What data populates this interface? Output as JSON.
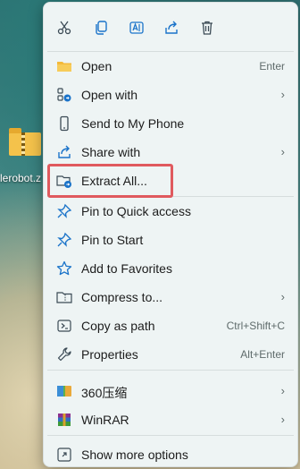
{
  "desktop": {
    "zip_file_label": "lerobot.z"
  },
  "toolbar": {
    "buttons": [
      "cut",
      "copy",
      "rename",
      "share",
      "delete"
    ]
  },
  "menu": {
    "items": [
      {
        "label": "Open",
        "shortcut": "Enter",
        "icon": "folder-open-icon"
      },
      {
        "label": "Open with",
        "has_submenu": true,
        "icon": "open-with-icon"
      },
      {
        "label": "Send to My Phone",
        "icon": "phone-icon"
      },
      {
        "label": "Share with",
        "has_submenu": true,
        "icon": "share-icon"
      },
      {
        "label": "Extract All...",
        "icon": "extract-icon",
        "highlighted": true
      },
      {
        "label": "Pin to Quick access",
        "icon": "pin-icon"
      },
      {
        "label": "Pin to Start",
        "icon": "pin-icon"
      },
      {
        "label": "Add to Favorites",
        "icon": "star-icon"
      },
      {
        "label": "Compress to...",
        "has_submenu": true,
        "icon": "zip-folder-icon"
      },
      {
        "label": "Copy as path",
        "shortcut": "Ctrl+Shift+C",
        "icon": "copy-path-icon"
      },
      {
        "label": "Properties",
        "shortcut": "Alt+Enter",
        "icon": "wrench-icon"
      },
      {
        "label": "360压缩",
        "has_submenu": true,
        "icon": "archive-360-icon"
      },
      {
        "label": "WinRAR",
        "has_submenu": true,
        "icon": "winrar-icon"
      },
      {
        "label": "Show more options",
        "icon": "more-options-icon"
      }
    ],
    "chevron": "›"
  },
  "colors": {
    "menu_bg": "#eef4f4",
    "accent_blue": "#1a73c9",
    "highlight_red": "#e05a5e"
  }
}
